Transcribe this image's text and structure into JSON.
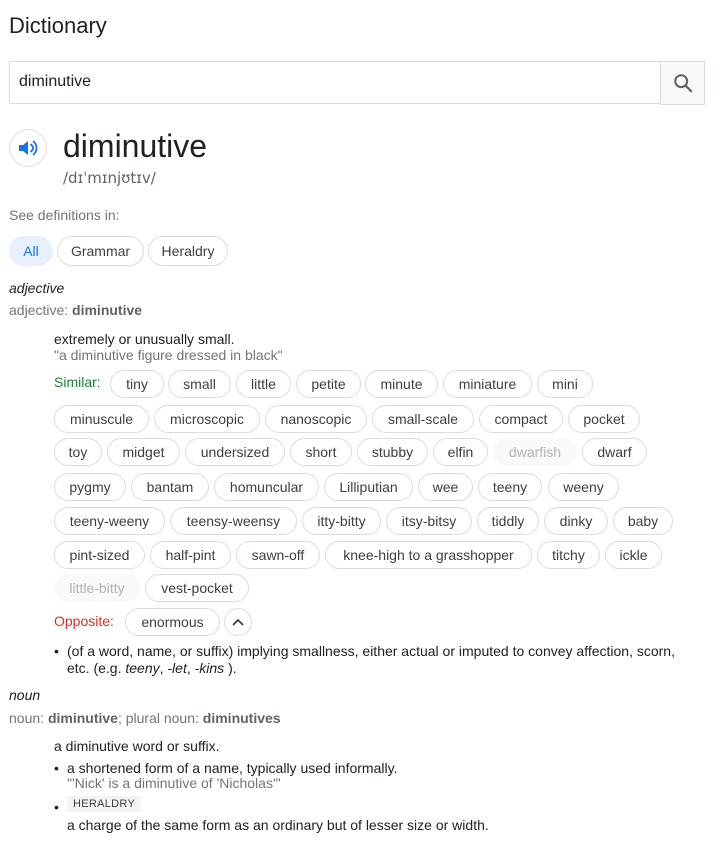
{
  "app": {
    "title": "Dictionary"
  },
  "search": {
    "value": "diminutive"
  },
  "entry": {
    "word": "diminutive",
    "phonetic": "/dɪˈmɪnjʊtɪv/",
    "see_definitions": "See definitions in:",
    "domain_chips": [
      "All",
      "Grammar",
      "Heraldry"
    ],
    "adjective": {
      "pos": "adjective",
      "pos_prefix": "adjective: ",
      "pos_word": "diminutive",
      "definition": "extremely or unusually small.",
      "example": "\"a diminutive figure dressed in black\"",
      "similar_label": "Similar:",
      "similar": [
        "tiny",
        "small",
        "little",
        "petite",
        "minute",
        "miniature",
        "mini",
        "minuscule",
        "microscopic",
        "nanoscopic",
        "small-scale",
        "compact",
        "pocket",
        "toy",
        "midget",
        "undersized",
        "short",
        "stubby",
        "elfin",
        "dwarfish",
        "dwarf",
        "pygmy",
        "bantam",
        "homuncular",
        "Lilliputian",
        "wee",
        "teeny",
        "weeny",
        "teeny-weeny",
        "teensy-weensy",
        "itty-bitty",
        "itsy-bitsy",
        "tiddly",
        "dinky",
        "baby",
        "pint-sized",
        "half-pint",
        "sawn-off",
        "knee-high to a grasshopper",
        "titchy",
        "ickle",
        "little-bitty",
        "vest-pocket"
      ],
      "opposite_label": "Opposite:",
      "opposite": [
        "enormous"
      ],
      "sub_def_1": "(of a word, name, or suffix) implying smallness, either actual or imputed to convey affection, scorn,",
      "sub_def_2a": "etc. (e.g. ",
      "sub_def_teeny": "teeny",
      "sub_def_sep1": ", ",
      "sub_def_let": "-let",
      "sub_def_sep2": ", ",
      "sub_def_kins": "-kins",
      "sub_def_end": " )."
    },
    "noun": {
      "pos": "noun",
      "pos_prefix": "noun: ",
      "pos_word": "diminutive",
      "plural_prefix": "; plural noun: ",
      "plural_word": "diminutives",
      "definition": "a diminutive word or suffix.",
      "sense1": "a shortened form of a name, typically used informally.",
      "sense1_example": "\"'Nick' is a diminutive of 'Nicholas'\"",
      "sense2_tag": "HERALDRY",
      "sense2": "a charge of the same form as an ordinary but of lesser size or width."
    }
  },
  "icons": {
    "search": "search-icon",
    "speaker": "speaker-icon",
    "collapse": "chevron-up-icon"
  },
  "colors": {
    "accent": "#1a73e8",
    "similar": "#188038",
    "opposite": "#d93025"
  }
}
